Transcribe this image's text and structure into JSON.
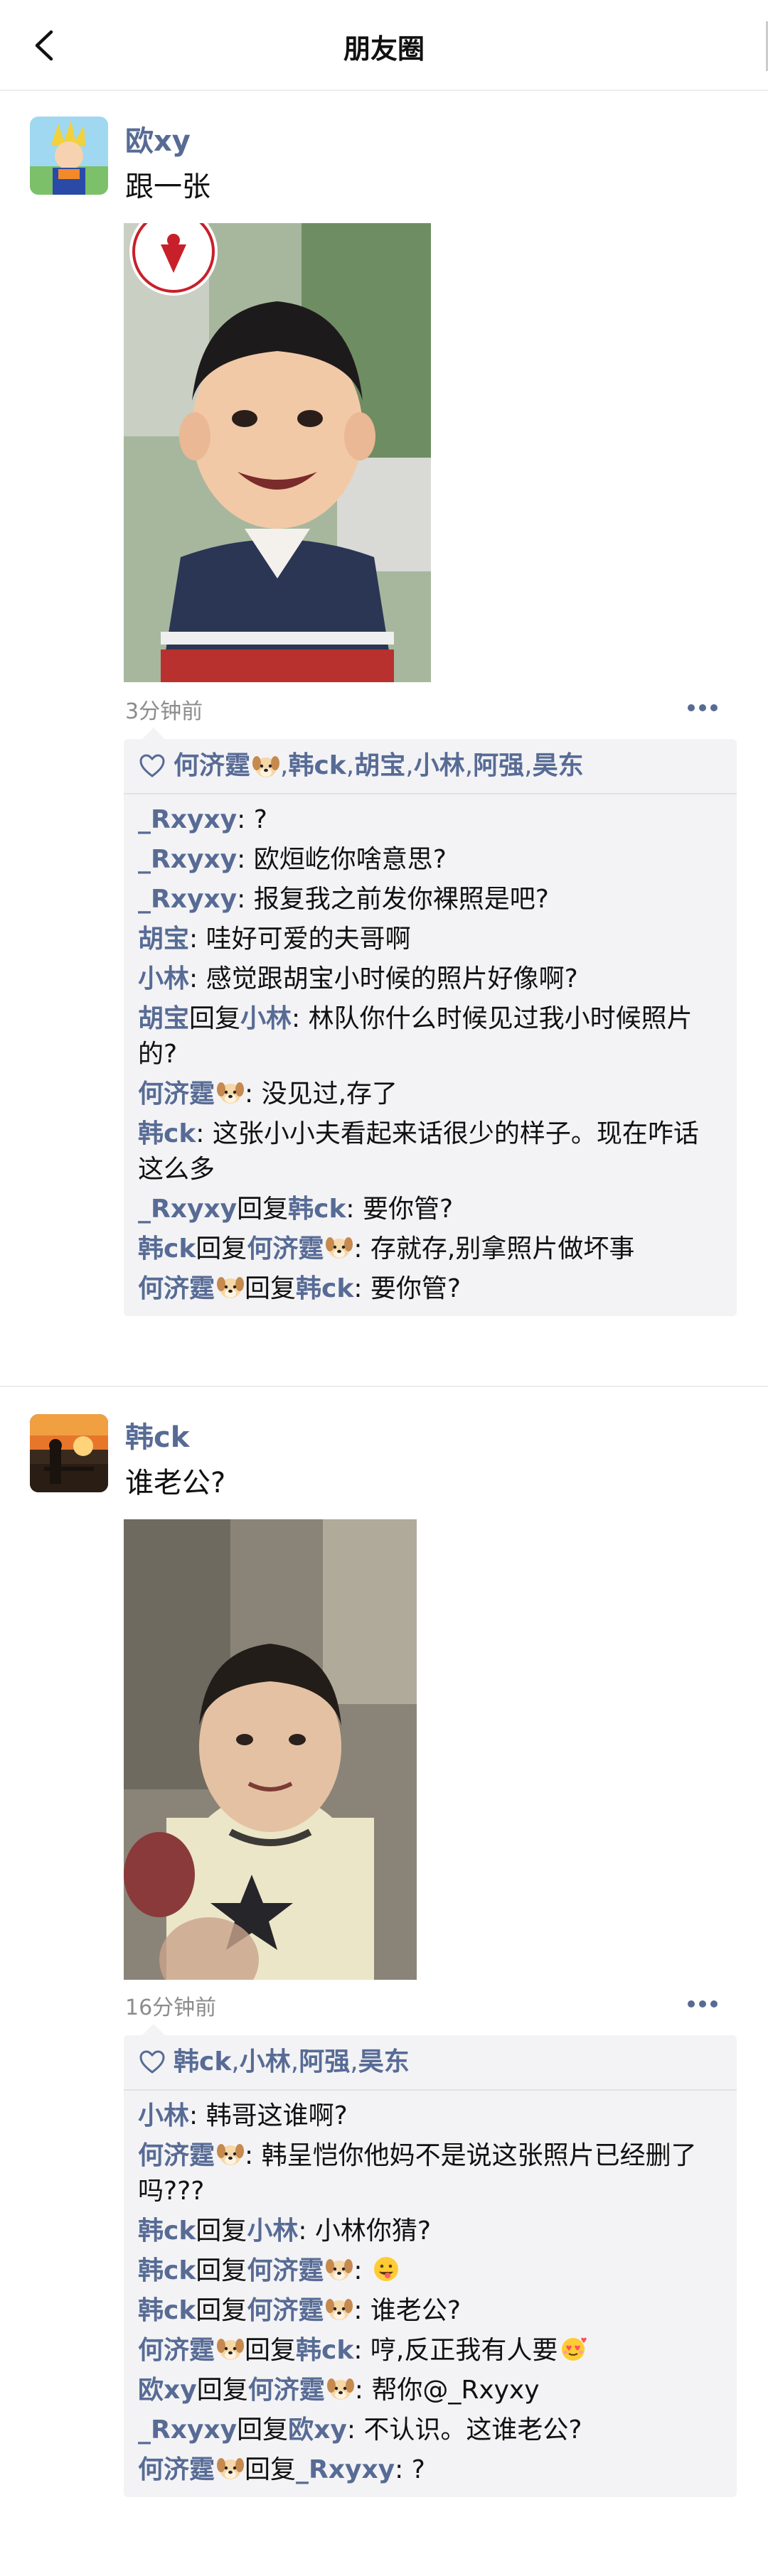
{
  "topbar": {
    "title": "朋友圈"
  },
  "colors": {
    "accent": "#576b95",
    "meta": "#8c8c8c",
    "panel": "#f3f3f5"
  },
  "posts": [
    {
      "author": "欧xy",
      "text": "跟一张",
      "time": "3分钟前",
      "likes": [
        "何济霆",
        "韩ck",
        "胡宝",
        "小林",
        "阿强",
        "昊东"
      ],
      "comments": [
        {
          "from": "_Rxyxy",
          "text": "?"
        },
        {
          "from": "_Rxyxy",
          "text": "欧烜屹你啥意思?"
        },
        {
          "from": "_Rxyxy",
          "text": "报复我之前发你裸照是吧?"
        },
        {
          "from": "胡宝",
          "text": "哇好可爱的夫哥啊"
        },
        {
          "from": "小林",
          "text": "感觉跟胡宝小时候的照片好像啊?"
        },
        {
          "from": "胡宝",
          "reply_word": "回复",
          "to": "小林",
          "text": "林队你什么时候见过我小时候照片的?"
        },
        {
          "from": "何济霆",
          "text": "没见过,存了"
        },
        {
          "from": "韩ck",
          "text": "这张小小夫看起来话很少的样子。现在咋话这么多"
        },
        {
          "from": "_Rxyxy",
          "reply_word": "回复",
          "to": "韩ck",
          "text": "要你管?"
        },
        {
          "from": "韩ck",
          "reply_word": "回复",
          "to": "何济霆",
          "text": "存就存,别拿照片做坏事"
        },
        {
          "from": "何济霆",
          "reply_word": "回复",
          "to": "韩ck",
          "text": "要你管?"
        }
      ]
    },
    {
      "author": "韩ck",
      "text": "谁老公?",
      "time": "16分钟前",
      "likes": [
        "韩ck",
        "小林",
        "阿强",
        "昊东"
      ],
      "comments": [
        {
          "from": "小林",
          "text": "韩哥这谁啊?"
        },
        {
          "from": "何济霆",
          "text": "韩呈恺你他妈不是说这张照片已经删了吗???"
        },
        {
          "from": "韩ck",
          "reply_word": "回复",
          "to": "小林",
          "text": "小林你猜?"
        },
        {
          "from": "韩ck",
          "reply_word": "回复",
          "to": "何济霆",
          "text": ""
        },
        {
          "from": "韩ck",
          "reply_word": "回复",
          "to": "何济霆",
          "text": "谁老公?"
        },
        {
          "from": "何济霆",
          "reply_word": "回复",
          "to": "韩ck",
          "text": "哼,反正我有人要"
        },
        {
          "from": "欧xy",
          "reply_word": "回复",
          "to": "何济霆",
          "text": "帮你@_Rxyxy"
        },
        {
          "from": "_Rxyxy",
          "reply_word": "回复",
          "to": "欧xy",
          "text": "不认识。这谁老公?"
        },
        {
          "from": "何济霆",
          "reply_word": "回复",
          "to": "_Rxyxy",
          "text": "?"
        }
      ]
    }
  ]
}
